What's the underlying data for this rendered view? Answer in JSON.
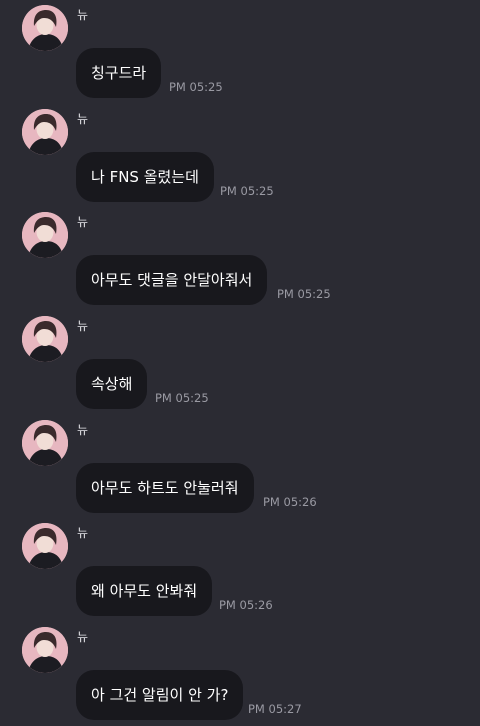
{
  "messages": [
    {
      "sender": "뉴",
      "text": "칭구드라",
      "time": "PM 05:25",
      "avatar": "profile-photo"
    },
    {
      "sender": "뉴",
      "text": "나 FNS 올렸는데",
      "time": "PM 05:25",
      "avatar": "profile-photo"
    },
    {
      "sender": "뉴",
      "text": "아무도 댓글을 안달아줘서",
      "time": "PM 05:25",
      "avatar": "profile-photo"
    },
    {
      "sender": "뉴",
      "text": "속상해",
      "time": "PM 05:25",
      "avatar": "profile-photo"
    },
    {
      "sender": "뉴",
      "text": "아무도 하트도 안눌러줘",
      "time": "PM 05:26",
      "avatar": "profile-photo"
    },
    {
      "sender": "뉴",
      "text": "왜 아무도 안봐줘",
      "time": "PM 05:26",
      "avatar": "profile-photo"
    },
    {
      "sender": "뉴",
      "text": "아 그건 알림이 안 가?",
      "time": "PM 05:27",
      "avatar": "profile-photo"
    }
  ],
  "colors": {
    "background": "#2b2b33",
    "bubble": "#18181d",
    "bubble_text": "#ffffff",
    "time_text": "#9a9aa3",
    "avatar_bg": "#e7b7c0"
  }
}
